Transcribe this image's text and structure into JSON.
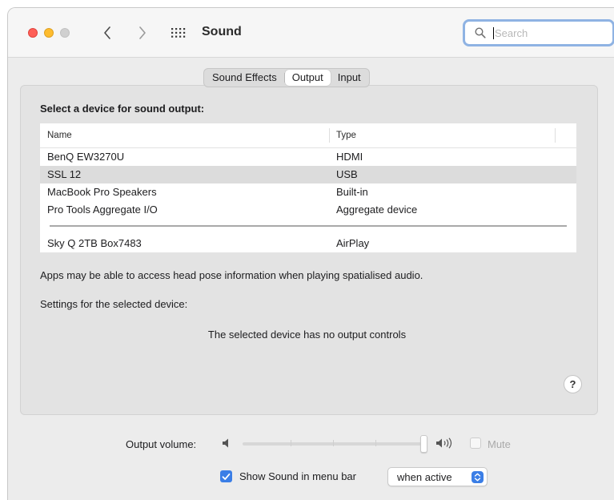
{
  "window": {
    "title": "Sound",
    "search_placeholder": "Search"
  },
  "icons": {
    "back": "chevron-left-icon",
    "forward": "chevron-right-icon",
    "grid": "grid-icon",
    "search": "magnifier-icon"
  },
  "tabs": [
    {
      "label": "Sound Effects",
      "active": false
    },
    {
      "label": "Output",
      "active": true
    },
    {
      "label": "Input",
      "active": false
    }
  ],
  "output": {
    "heading": "Select a device for sound output:",
    "columns": [
      "Name",
      "Type"
    ],
    "devices": [
      {
        "name": "BenQ EW3270U",
        "type": "HDMI",
        "selected": false
      },
      {
        "name": "SSL 12",
        "type": "USB",
        "selected": true
      },
      {
        "name": "MacBook Pro Speakers",
        "type": "Built-in",
        "selected": false
      },
      {
        "name": "Pro Tools Aggregate I/O",
        "type": "Aggregate device",
        "selected": false
      }
    ],
    "airplay_devices": [
      {
        "name": "Sky Q 2TB Box7483",
        "type": "AirPlay"
      }
    ],
    "note": "Apps may be able to access head pose information when playing spatialised audio.",
    "settings_label": "Settings for the selected device:",
    "no_controls": "The selected device has no output controls",
    "help": "?"
  },
  "bottom": {
    "volume_label": "Output volume:",
    "volume_level": 1.0,
    "mute_label": "Mute",
    "mute_checked": false,
    "show_in_menu_label": "Show Sound in menu bar",
    "show_in_menu_checked": true,
    "when_value": "when active"
  },
  "colors": {
    "accent": "#3b7ee6",
    "close": "#fe5f57",
    "minimize": "#febc2e",
    "zoom_disabled": "#d0d0d0"
  }
}
